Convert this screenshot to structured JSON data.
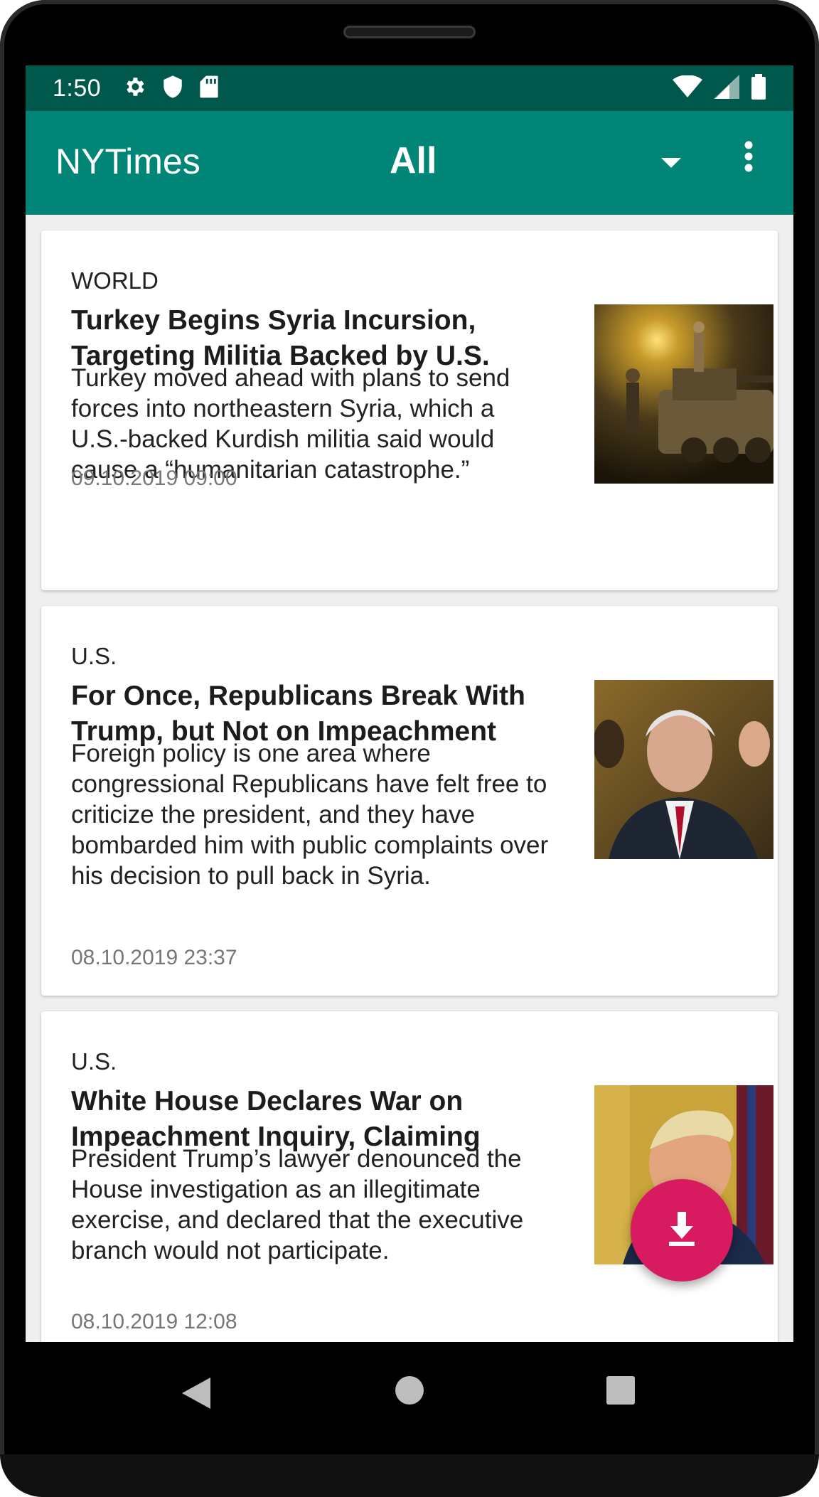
{
  "status_bar": {
    "time": "1:50",
    "left_icons": [
      "gear-icon",
      "shield-icon",
      "sd-card-icon"
    ],
    "right_icons": [
      "wifi-icon",
      "cell-signal-icon",
      "battery-icon"
    ]
  },
  "app_bar": {
    "title": "NYTimes",
    "filter_value": "All",
    "filter_icon": "dropdown-arrow-icon",
    "menu_icon": "overflow-menu-icon"
  },
  "articles": [
    {
      "section": "WORLD",
      "title": "Turkey Begins Syria Incursion, Targeting Militia Backed by U.S.",
      "abstract": "Turkey moved ahead with plans to send forces into northeastern Syria, which a U.S.-backed Kurdish militia said would cause a “humanitarian catastrophe.”",
      "date": "09.10.2019 09:00"
    },
    {
      "section": "U.S.",
      "title": "For Once, Republicans Break With Trump, but Not on Impeachment",
      "abstract": "Foreign policy is one area where congressional Republicans have felt free to criticize the president, and they have bombarded him with public complaints over his decision to pull back in Syria.",
      "date": "08.10.2019 23:37"
    },
    {
      "section": "U.S.",
      "title": "White House Declares War on Impeachment Inquiry, Claiming",
      "abstract": "President Trump’s lawyer denounced the House investigation as an illegitimate exercise, and declared that the executive branch would not participate.",
      "date": "08.10.2019 12:08"
    }
  ],
  "fab": {
    "icon": "download-icon",
    "color": "#d81b60"
  },
  "nav_bar": {
    "icons": [
      "back-icon",
      "home-icon",
      "recents-icon"
    ]
  },
  "colors": {
    "status_bar": "#00574b",
    "app_bar": "#008577",
    "accent": "#d81b60"
  }
}
